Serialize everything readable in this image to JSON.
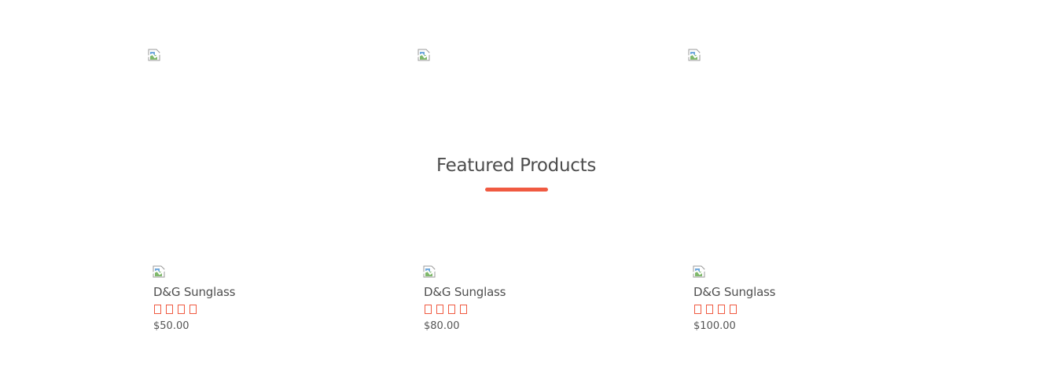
{
  "banners": [
    {
      "alt": "",
      "icon": "broken-image-icon"
    },
    {
      "alt": "",
      "icon": "broken-image-icon"
    },
    {
      "alt": "",
      "icon": "broken-image-icon"
    }
  ],
  "featured": {
    "title": "Featured Products",
    "accent_color": "#f05a41"
  },
  "products": [
    {
      "name": "D&G Sunglass",
      "price": "$50.00",
      "rating": 0
    },
    {
      "name": "D&G Sunglass",
      "price": "$80.00",
      "rating": 0
    },
    {
      "name": "D&G Sunglass",
      "price": "$100.00",
      "rating": 0
    }
  ]
}
